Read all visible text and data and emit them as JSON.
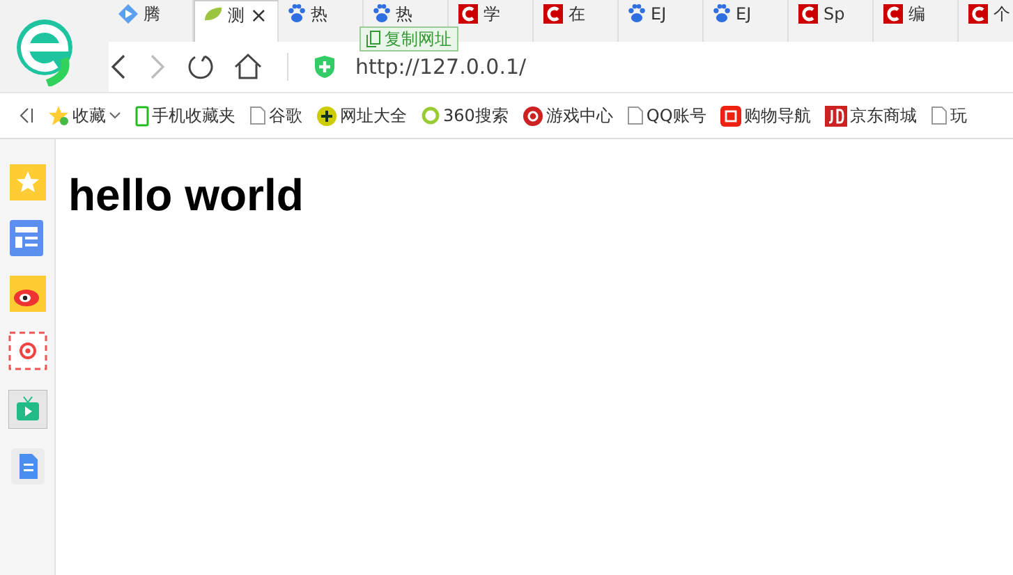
{
  "tabs": [
    {
      "label": "腾",
      "kind": "video",
      "selected": false
    },
    {
      "label": "测",
      "kind": "leaf",
      "selected": true,
      "close": "×"
    },
    {
      "label": "热",
      "kind": "paw",
      "selected": false
    },
    {
      "label": "热",
      "kind": "paw",
      "selected": false
    },
    {
      "label": "学",
      "kind": "csdn",
      "selected": false
    },
    {
      "label": "在",
      "kind": "csdn",
      "selected": false
    },
    {
      "label": "EJ",
      "kind": "paw",
      "selected": false
    },
    {
      "label": "EJ",
      "kind": "paw",
      "selected": false
    },
    {
      "label": "Sp",
      "kind": "csdn",
      "selected": false
    },
    {
      "label": "编",
      "kind": "csdn",
      "selected": false
    },
    {
      "label": "个",
      "kind": "csdn",
      "selected": false
    }
  ],
  "tooltip": "复制网址",
  "address": {
    "url": "http://127.0.0.1/"
  },
  "bookmarks": [
    {
      "label": "收藏",
      "kind": "star",
      "dropdown": true
    },
    {
      "label": "手机收藏夹",
      "kind": "phone"
    },
    {
      "label": "谷歌",
      "kind": "page"
    },
    {
      "label": "网址大全",
      "kind": "plus"
    },
    {
      "label": "360搜索",
      "kind": "ring"
    },
    {
      "label": "游戏中心",
      "kind": "cs"
    },
    {
      "label": "QQ账号",
      "kind": "page"
    },
    {
      "label": "购物导航",
      "kind": "hui"
    },
    {
      "label": "京东商城",
      "kind": "jd"
    },
    {
      "label": "玩",
      "kind": "page"
    }
  ],
  "page": {
    "heading": "hello world"
  }
}
